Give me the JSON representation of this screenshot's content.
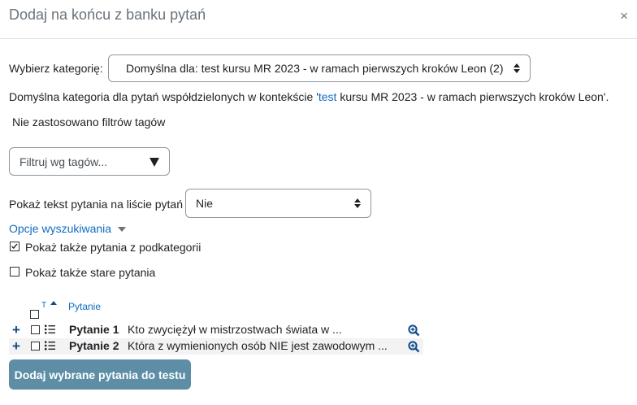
{
  "header": {
    "title": "Dodaj na końcu z banku pytań",
    "close_label": "×"
  },
  "category": {
    "label": "Wybierz kategorię:",
    "selected": "Domyślna dla: test kursu MR 2023 - w ramach pierwszych kroków Leon (2)",
    "description_pre": "Domyślna kategoria dla pytań współdzielonych w kontekście '",
    "description_link": "test",
    "description_post": " kursu MR 2023 - w ramach pierwszych kroków Leon'."
  },
  "tags": {
    "no_filter_text": "Nie zastosowano filtrów tagów",
    "placeholder": "Filtruj wg tagów..."
  },
  "show_text": {
    "label": "Pokaż tekst pytania na liście pytań",
    "selected": "Nie"
  },
  "search_options": {
    "label": "Opcje wyszukiwania",
    "subcategories": {
      "label": "Pokaż także pytania z podkategorii",
      "checked": true
    },
    "old_questions": {
      "label": "Pokaż także stare pytania",
      "checked": false
    }
  },
  "table": {
    "type_header": "T",
    "question_header": "Pytanie",
    "rows": [
      {
        "name": "Pytanie 1",
        "text": "Kto zwyciężył w mistrzostwach świata w ..."
      },
      {
        "name": "Pytanie 2",
        "text": "Która z wymienionych osób NIE jest zawodowym ..."
      }
    ]
  },
  "add_button": "Dodaj wybrane pytania do testu",
  "colors": {
    "link": "#0f6cbf",
    "button": "#5d8ea6",
    "icon": "#0f4d8a"
  }
}
